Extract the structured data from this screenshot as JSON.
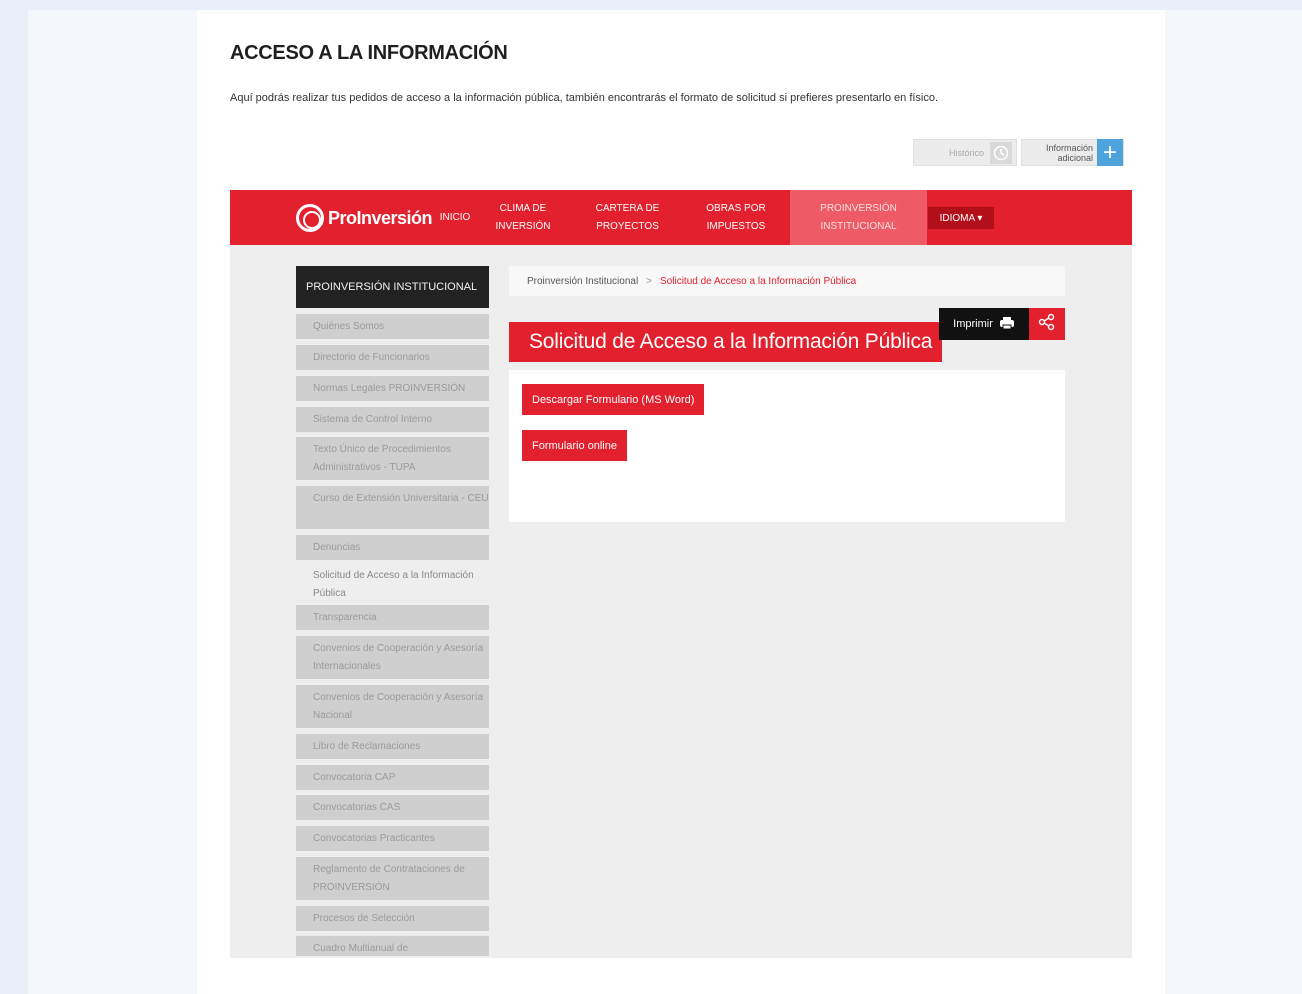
{
  "page": {
    "title": "ACCESO A LA INFORMACIÓN",
    "description": "Aquí podrás realizar tus pedidos de acceso a la información pública, también encontrarás el formato de solicitud si prefieres presentarlo en físico."
  },
  "toolbar": {
    "historico_label": "Histórico",
    "info_label_line1": "Información",
    "info_label_line2": "adicional"
  },
  "site": {
    "logo_text": "ProInversión",
    "nav": [
      {
        "label_line1": "INICIO",
        "label_line2": ""
      },
      {
        "label_line1": "CLIMA DE",
        "label_line2": "INVERSIÓN"
      },
      {
        "label_line1": "CARTERA DE",
        "label_line2": "PROYECTOS"
      },
      {
        "label_line1": "OBRAS POR",
        "label_line2": "IMPUESTOS"
      },
      {
        "label_line1": "PROINVERSIÓN",
        "label_line2": "INSTITUCIONAL"
      }
    ],
    "idioma_label": "IDIOMA ▾"
  },
  "sidebar": {
    "heading": "PROINVERSIÓN INSTITUCIONAL",
    "items": [
      {
        "label": "Quiénes Somos"
      },
      {
        "label": "Directorio de Funcionarios"
      },
      {
        "label": "Normas Legales PROINVERSIÓN"
      },
      {
        "label": "Sistema de Control Interno"
      },
      {
        "label": "Texto Único de Procedimientos Administrativos - TUPA"
      },
      {
        "label": "Curso de Extensión Universitaria - CEU"
      },
      {
        "label": "Denuncias"
      },
      {
        "label": "Solicitud de Acceso a la Información Pública"
      },
      {
        "label": "Transparencia"
      },
      {
        "label": "Convenios de Cooperación y Asesoría Internacionales"
      },
      {
        "label": "Convenios de Cooperación y Asesoría Nacional"
      },
      {
        "label": "Libro de Reclamaciones"
      },
      {
        "label": "Convocatoria CAP"
      },
      {
        "label": "Convocatorias CAS"
      },
      {
        "label": "Convocatorias Practicantes"
      },
      {
        "label": "Reglamento de Contrataciones de PROINVERSIÓN"
      },
      {
        "label": "Procesos de Selección"
      },
      {
        "label": "Cuadro Multianual de"
      }
    ]
  },
  "breadcrumb": {
    "parent": "Proinversión Institucional",
    "separator": ">",
    "current": "Solicitud de Acceso a la Información Pública"
  },
  "main": {
    "section_title": "Solicitud de Acceso a la Información Pública",
    "print_label": "Imprimir",
    "download_button": "Descargar Formulario (MS Word)",
    "online_button": "Formulario online"
  }
}
